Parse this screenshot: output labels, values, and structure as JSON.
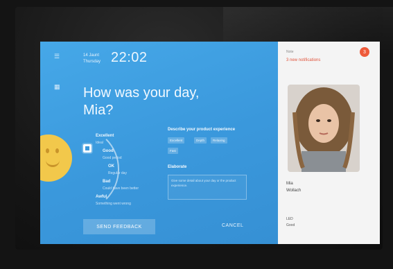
{
  "header": {
    "date_line1": "14 Jaunt",
    "date_line2": "Thursday",
    "time": "22:02"
  },
  "main": {
    "greeting_line1": "How was your day,",
    "greeting_line2": "Mia?",
    "moods": [
      {
        "label": "Excellent",
        "sub": "Ideal"
      },
      {
        "label": "Good",
        "sub": "Good period"
      },
      {
        "label": "OK",
        "sub": "Regular day"
      },
      {
        "label": "Bad",
        "sub": "Could have been better"
      },
      {
        "label": "Awful",
        "sub": "Something went wrong"
      }
    ],
    "describe_title": "Describe your product experience",
    "chips": [
      "Excellent",
      "Depth",
      "Relaxing",
      "Fast"
    ],
    "elaborate_title": "Elaborate",
    "elaborate_placeholder": "Give some detail about your day or the product experience.",
    "send_label": "SEND FEEDBACK",
    "cancel_label": "CANCEL"
  },
  "sidebar": {
    "label": "Note",
    "notifications": "3 new notifications",
    "badge": "3",
    "first_name": "Mia",
    "last_name": "Wollach",
    "mood_label": "LED",
    "mood_value": "Good"
  },
  "colors": {
    "screen_blue": "#3d9de0",
    "accent_orange": "#ee5a3a",
    "face_yellow": "#f2c84b"
  }
}
